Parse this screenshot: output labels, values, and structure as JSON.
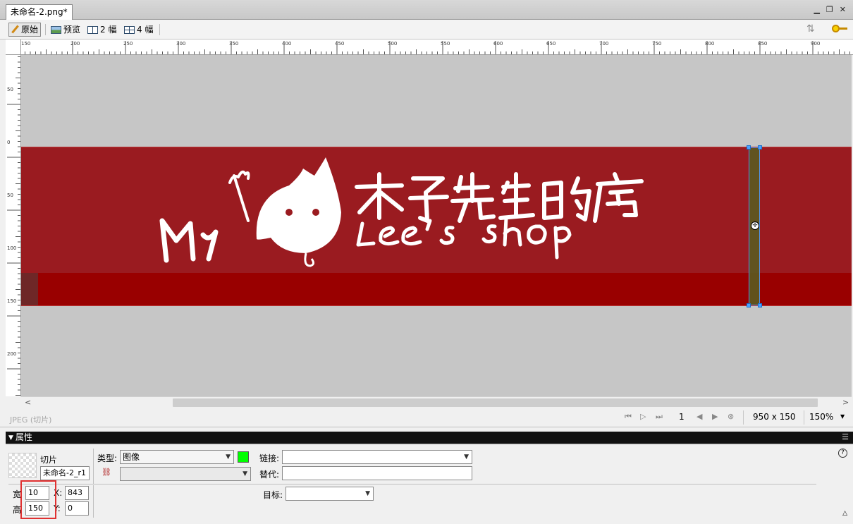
{
  "document": {
    "tab_title": "未命名-2.png*"
  },
  "view_toolbar": {
    "original_label": "原始",
    "preview_label": "预览",
    "two_up_label": "2 幅",
    "four_up_label": "4 幅"
  },
  "ruler": {
    "top_labels": [
      "150",
      "200",
      "250",
      "300",
      "350",
      "400",
      "450",
      "500",
      "550",
      "600",
      "650",
      "700",
      "750",
      "800",
      "850",
      "900"
    ],
    "left_labels": [
      "50",
      "0",
      "50",
      "100",
      "150",
      "200"
    ]
  },
  "canvas": {
    "banner_color": "#9a1b20",
    "logo_text_en": "My",
    "logo_text_zh": "木子先生的店",
    "logo_text_shop": "Lee's shop"
  },
  "statusbar": {
    "format_label": "JPEG (切片)",
    "frame": "1",
    "dimensions": "950 x 150",
    "zoom": "150%"
  },
  "properties": {
    "header": "属性",
    "slice_label": "切片",
    "slice_name": "未命名-2_r1",
    "type_label": "类型:",
    "type_value": "图像",
    "slice_color": "#00ff00",
    "link_label": "链接:",
    "link_value": "",
    "alt_label": "替代:",
    "alt_value": "",
    "target_label": "目标:",
    "target_value": "",
    "width_label": "宽",
    "width_value": "10",
    "height_label": "高",
    "height_value": "150",
    "x_label": "X:",
    "x_value": "843",
    "y_label": "Y:",
    "y_value": "0"
  }
}
